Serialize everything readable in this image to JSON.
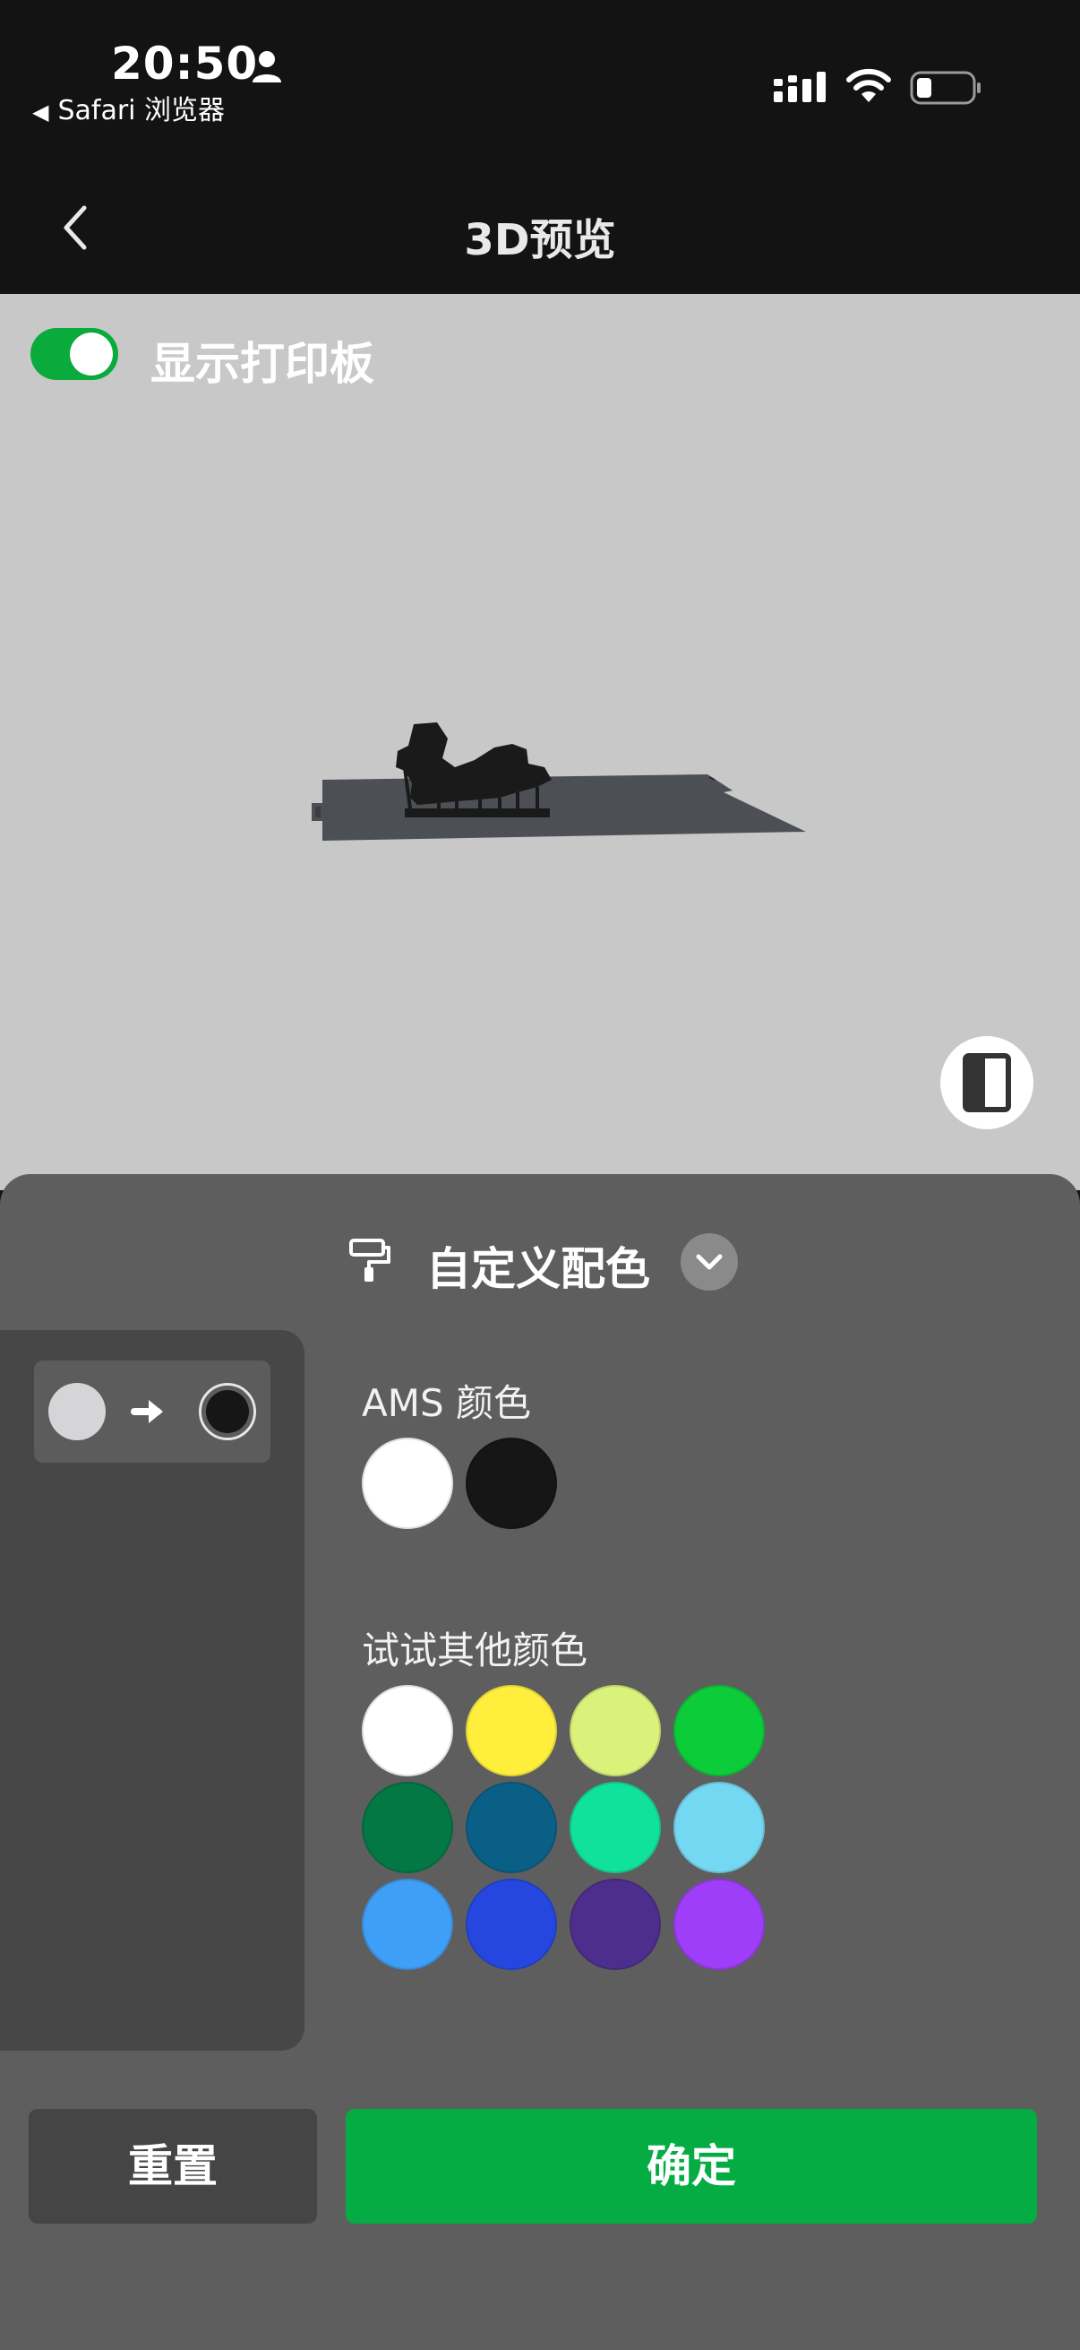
{
  "status_bar": {
    "time": "20:50",
    "back_app": "Safari 浏览器",
    "back_glyph": "◀"
  },
  "nav": {
    "title": "3D预览"
  },
  "viewport": {
    "toggle_label": "显示打印板",
    "toggle_on": true,
    "background_color": "#c8c8c8",
    "plate_color": "#4c4f54",
    "model_color": "#1a1a1a"
  },
  "sheet": {
    "title": "自定义配色",
    "mapping": {
      "from_color": "#d5d5d7",
      "to_color": "#161616"
    },
    "ams_label": "AMS 颜色",
    "ams_colors": [
      "#ffffff",
      "#161616"
    ],
    "other_label": "试试其他颜色",
    "other_colors": [
      "#ffffff",
      "#ffef3c",
      "#dbf27a",
      "#0ccc3a",
      "#037744",
      "#0a5f86",
      "#10e29c",
      "#75d8f2",
      "#3f9ef5",
      "#2547e0",
      "#4d2e8c",
      "#9f3ef8"
    ],
    "reset_label": "重置",
    "confirm_label": "确定"
  },
  "accent_color": "#05ac43"
}
